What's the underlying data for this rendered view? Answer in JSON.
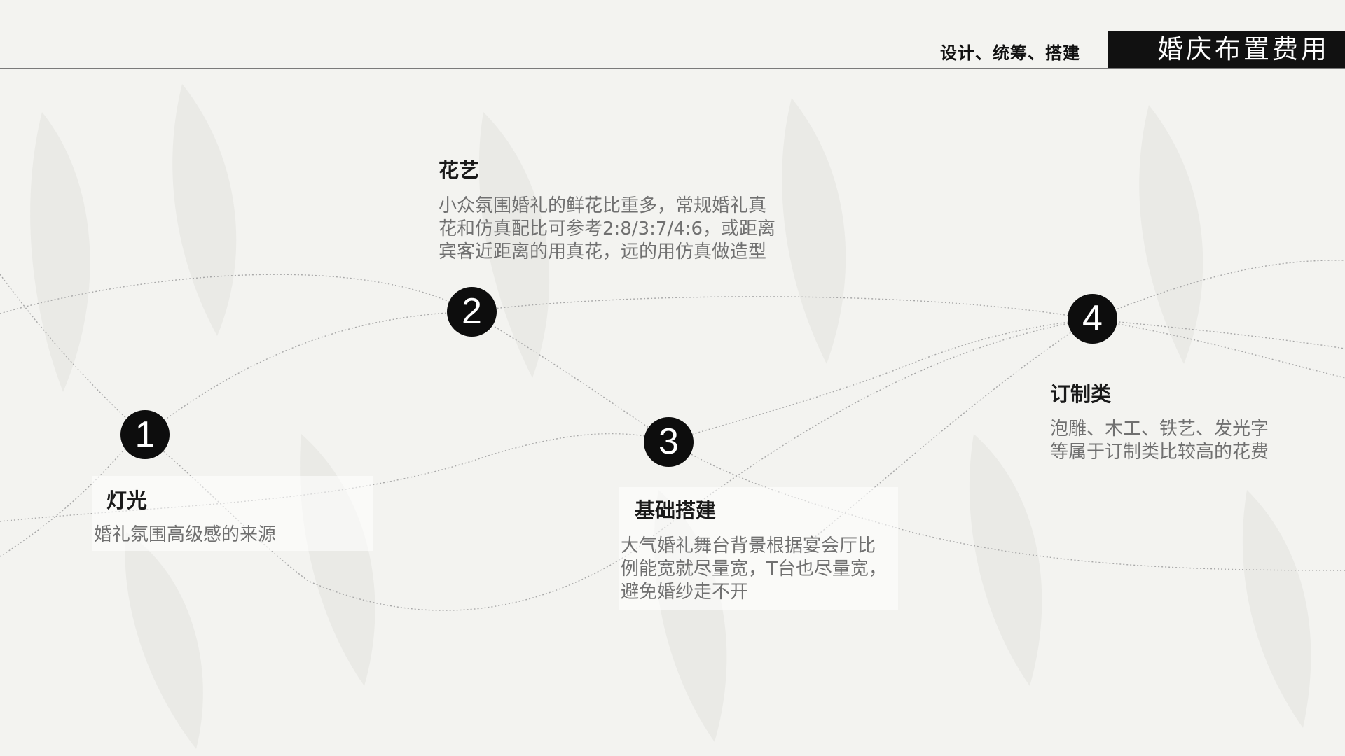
{
  "header": {
    "subtitle": "设计、统筹、搭建",
    "title": "婚庆布置费用"
  },
  "items": [
    {
      "number": "1",
      "title": "灯光",
      "desc_lines": [
        "婚礼氛围高级感的来源"
      ]
    },
    {
      "number": "2",
      "title": "花艺",
      "desc_lines": [
        "小众氛围婚礼的鲜花比重多，常规婚礼真",
        "花和仿真配比可参考2:8/3:7/4:6，或距离",
        "宾客近距离的用真花，远的用仿真做造型"
      ]
    },
    {
      "number": "3",
      "title": "基础搭建",
      "desc_lines": [
        "大气婚礼舞台背景根据宴会厅比",
        "例能宽就尽量宽，T台也尽量宽，",
        "避免婚纱走不开"
      ]
    },
    {
      "number": "4",
      "title": "订制类",
      "desc_lines": [
        "泡雕、木工、铁艺、发光字",
        "等属于订制类比较高的花费"
      ]
    }
  ]
}
